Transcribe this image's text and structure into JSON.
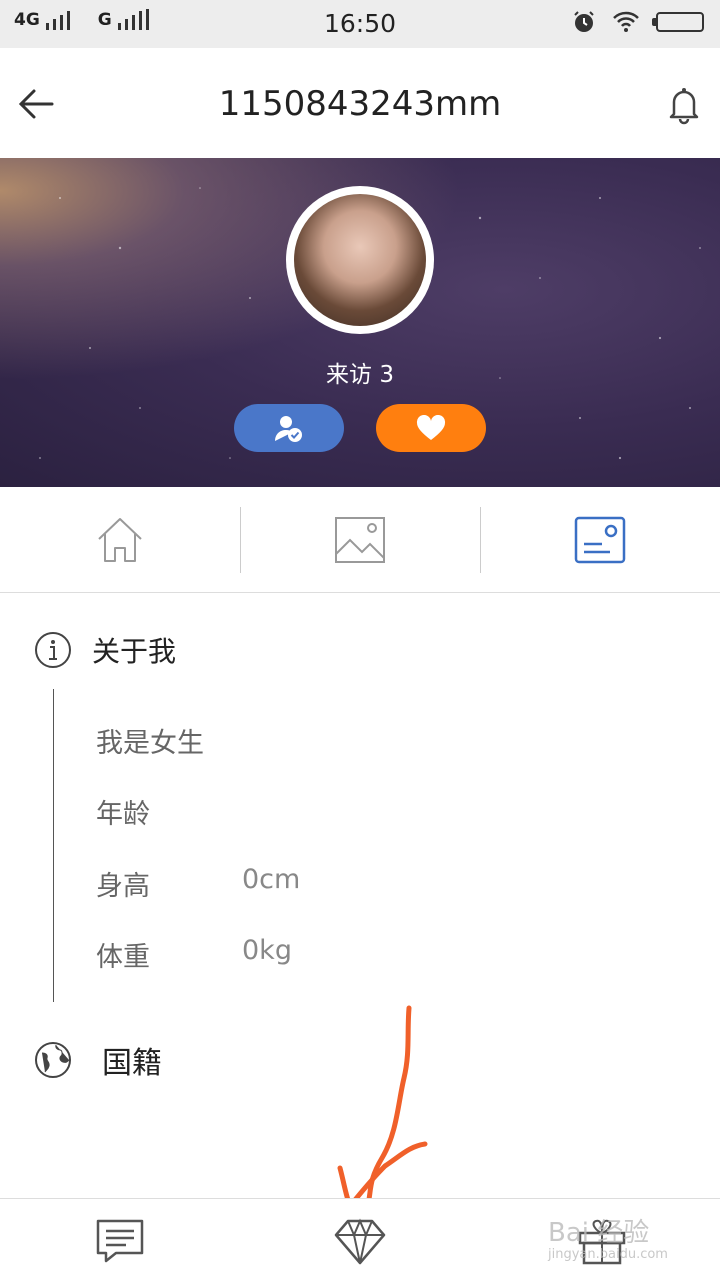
{
  "status": {
    "network1": "4G",
    "network2": "G",
    "time": "16:50"
  },
  "header": {
    "title": "1150843243mm",
    "back_icon": "arrow-left-icon",
    "notify_icon": "bell-icon"
  },
  "profile": {
    "visits_label": "来访 3",
    "follow_icon": "user-check-icon",
    "like_icon": "heart-icon",
    "follow_color": "#4a77c9",
    "like_color": "#ff7f0f"
  },
  "tabs": [
    {
      "icon": "home-icon",
      "active": false
    },
    {
      "icon": "image-icon",
      "active": false
    },
    {
      "icon": "profile-card-icon",
      "active": true
    }
  ],
  "about": {
    "title": "关于我",
    "rows": [
      {
        "label": "我是女生",
        "value": ""
      },
      {
        "label": "年龄",
        "value": ""
      },
      {
        "label": "身高",
        "value": "0cm"
      },
      {
        "label": "体重",
        "value": "0kg"
      }
    ]
  },
  "nationality": {
    "title": "国籍"
  },
  "bottom_nav": [
    {
      "icon": "chat-icon"
    },
    {
      "icon": "diamond-icon"
    },
    {
      "icon": "gift-icon"
    }
  ],
  "watermark": {
    "text": "Bai 经验",
    "sub": "jingyan.baidu.com"
  },
  "colors": {
    "accent": "#3a6fc4",
    "annotation": "#f0602a"
  }
}
